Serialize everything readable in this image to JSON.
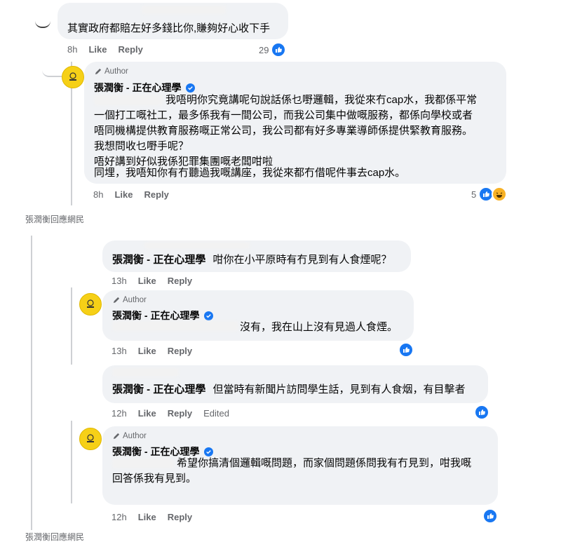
{
  "comments": [
    {
      "body": "其實政府都賠左好多錢比你,賺夠好心收下手",
      "time": "8h",
      "like": "Like",
      "reply": "Reply",
      "reactions": "29"
    },
    {
      "author_badge": "Author",
      "name": "張潤衡 - 正在心理學",
      "lines": [
        "我唔明你究竟講呢句說話係乜嘢邏輯，我從來冇cap水，我都係平常",
        "一個打工嘅社工，最多係我有一間公司，而我公司集中做嘅服務，都係向學校或者",
        "唔同機構提供教育服務嘅正常公司，我公司都有好多專業導師係提供緊教育服務。",
        "我想問收乜嘢手呢？",
        "唔好講到好似我係犯罪集團嘅老闆咁啦",
        "同埋，我唔知你有冇聽過我嘅講座，我從來都冇借呢件事去cap水。"
      ],
      "time": "8h",
      "like": "Like",
      "reply": "Reply",
      "reactions": "5"
    },
    {
      "name": "張潤衡 - 正在心理學",
      "body": "咁你在小平原時有冇見到有人食煙呢？",
      "time": "13h",
      "like": "Like",
      "reply": "Reply"
    },
    {
      "author_badge": "Author",
      "name": "張潤衡 - 正在心理學",
      "body": "沒有，我在山上沒有見過人食煙。",
      "time": "13h",
      "like": "Like",
      "reply": "Reply"
    },
    {
      "name": "張潤衡 - 正在心理學",
      "body": "但當時有新聞片訪問學生話，見到有人食烟，有目擊者",
      "time": "12h",
      "like": "Like",
      "reply": "Reply",
      "edited": "Edited"
    },
    {
      "author_badge": "Author",
      "name": "張潤衡 - 正在心理學",
      "lines": [
        "希望你搞清個邏輯嘅問題，而家個問題係問我有冇見到，咁我嘅",
        "回答係我有見到。"
      ],
      "time": "12h",
      "like": "Like",
      "reply": "Reply"
    }
  ],
  "reply_notes": [
    "張潤衡回應網民",
    "張潤衡回應網民"
  ],
  "icons": {
    "like": "like-icon",
    "haha": "haha-icon",
    "verified": "verified-badge-icon",
    "pen": "pen-icon"
  },
  "colors": {
    "bubble": "#f0f2f5",
    "like_blue": "#1877f2",
    "meta_gray": "#65676b"
  }
}
